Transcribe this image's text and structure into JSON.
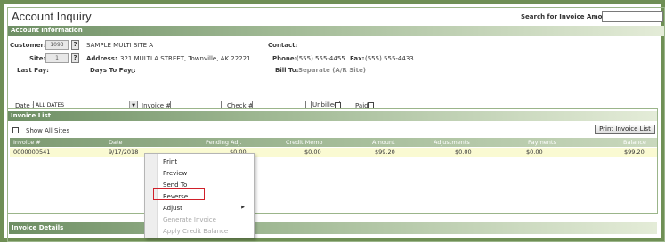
{
  "window": {
    "title": "Account Inquiry"
  },
  "search": {
    "label": "Search for Invoice Amount:",
    "value": ""
  },
  "account_info": {
    "section_title": "Account Information",
    "customer_label": "Customer:",
    "customer_number": "1093",
    "customer_name": "SAMPLE MULTI SITE A",
    "site_label": "Site:",
    "site_number": "1",
    "address_label": "Address:",
    "address_value": "321 MULTI A STREET, Townville, AK 22221",
    "last_pay_label": "Last Pay:",
    "last_pay_value": "",
    "days_to_pay_label": "Days To Pay :",
    "days_to_pay_value": "0",
    "contact_label": "Contact:",
    "contact_value": "",
    "phone_label": "Phone:",
    "phone_value": "(555) 555-4455",
    "fax_label": "Fax:",
    "fax_value": "(555) 555-4433",
    "bill_to_label": "Bill To:",
    "bill_to_value": "Separate (A/R Site)",
    "lookup_button": "?"
  },
  "filters": {
    "date_label": "Date :",
    "date_value": "ALL DATES",
    "invoice_label": "Invoice #:",
    "invoice_value": "",
    "check_label": "Check #:",
    "check_value": "",
    "unbilled_label": "Unbilled",
    "paid_label": "Paid"
  },
  "invoice_list": {
    "section_title": "Invoice List",
    "show_all_sites_label": "Show All Sites",
    "print_button": "Print Invoice List",
    "columns": [
      "Invoice #",
      "Date",
      "Pending Adj.",
      "Credit Memo",
      "Amount",
      "Adjustments",
      "Payments",
      "Balance"
    ],
    "rows": [
      [
        "0000000541",
        "9/17/2018",
        "$0.00",
        "$0.00",
        "$99.20",
        "$0.00",
        "$0.00",
        "$99.20"
      ]
    ]
  },
  "context_menu": {
    "items": [
      "Print",
      "Preview",
      "Send To",
      "Reverse",
      "Adjust",
      "Generate Invoice",
      "Apply Credit Balance"
    ],
    "highlighted": "Reverse",
    "highlight_color": "#d0202a"
  },
  "invoice_details": {
    "section_title": "Invoice Details"
  },
  "colors": {
    "frame": "#6f8f55",
    "header_green": "#6e8f64",
    "row_highlight": "#fafad2"
  }
}
